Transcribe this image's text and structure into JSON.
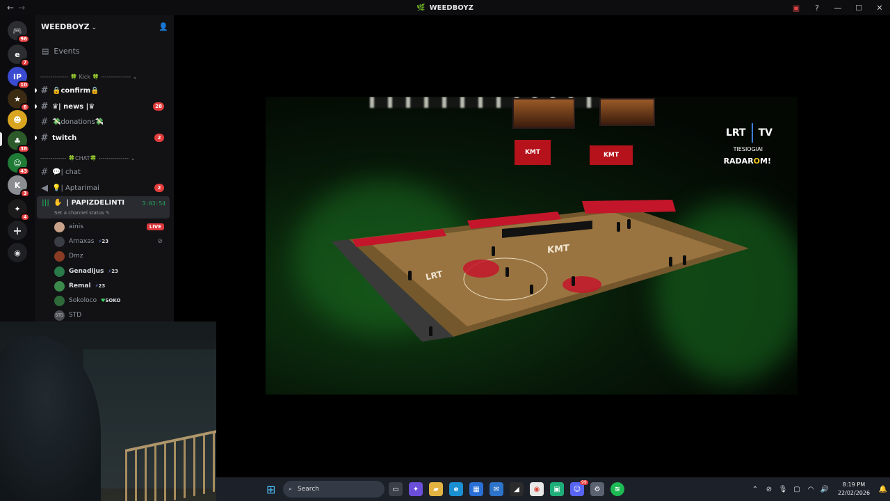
{
  "window": {
    "title": "WEEDBOYZ",
    "back_label": "←",
    "forward_label": "→",
    "minimize_label": "—",
    "maximize_label": "☐",
    "close_label": "✕",
    "help_label": "?"
  },
  "server_rail": {
    "home_badge": "96",
    "servers": [
      {
        "badge": "7",
        "color": "#2b2d31",
        "glyph": "e"
      },
      {
        "badge": "10",
        "color": "#3b4bd1",
        "glyph": "IP"
      },
      {
        "badge": "6",
        "color": "#3a2b12",
        "glyph": "★"
      },
      {
        "badge": "",
        "color": "#d9a521",
        "glyph": "☻"
      },
      {
        "badge": "38",
        "color": "#2d5a2a",
        "glyph": "♣"
      },
      {
        "badge": "43",
        "color": "#1f7a36",
        "glyph": "☺"
      },
      {
        "badge": "3",
        "color": "#8a8d92",
        "glyph": "K"
      },
      {
        "badge": "4",
        "color": "#1b1b1b",
        "glyph": "✦"
      }
    ]
  },
  "server": {
    "name": "WEEDBOYZ",
    "events_label": "Events"
  },
  "categories": {
    "kick": "-------------- 🍀 Kick 🍀 --------------- ⌄",
    "chat": "------------- 🍀CHAT🍀 --------------- ⌄"
  },
  "channels": [
    {
      "label": "confirm",
      "count": ""
    },
    {
      "label": "| news |",
      "count": "28"
    },
    {
      "label": "donations",
      "count": ""
    },
    {
      "label": "twitch",
      "count": "2"
    },
    {
      "label": "| chat",
      "count": ""
    },
    {
      "label": "| Aptarimai",
      "count": "2"
    }
  ],
  "voice_channel": {
    "name": "| PAPIZDELINTI",
    "timer": "3:03:54",
    "status": "Set a channel status"
  },
  "voice_users": [
    {
      "name": "ainis",
      "tag": "",
      "badge": "LIVE",
      "color": "#c9a28a"
    },
    {
      "name": "Arnaxas",
      "tag": "23",
      "badge": "",
      "color": "#3a3d44"
    },
    {
      "name": "Dmz",
      "tag": "",
      "badge": "",
      "color": "#8a3b24"
    },
    {
      "name": "Genadijus",
      "tag": "23",
      "badge": "",
      "color": "#2a7a4a"
    },
    {
      "name": "Remal",
      "tag": "23",
      "badge": "",
      "color": "#3c8a4c"
    },
    {
      "name": "Sokoloco",
      "tag": "SOKO",
      "badge": "",
      "color": "#2f6a3a"
    },
    {
      "name": "STD",
      "tag": "",
      "badge": "",
      "color": "#4a4d52"
    }
  ],
  "stream": {
    "broadcaster": "LRT",
    "broadcaster_tv": "TV",
    "tiesiogiai": "TIESIOGIAI",
    "radarom_a": "RADAR",
    "radarom_b": "O",
    "radarom_c": "M!",
    "court_ad": "KMT",
    "court_ad2": "LRT"
  },
  "taskbar": {
    "search_placeholder": "Search",
    "time": "8:19 PM",
    "date": "22/02/2026",
    "discord_badge": "99"
  }
}
